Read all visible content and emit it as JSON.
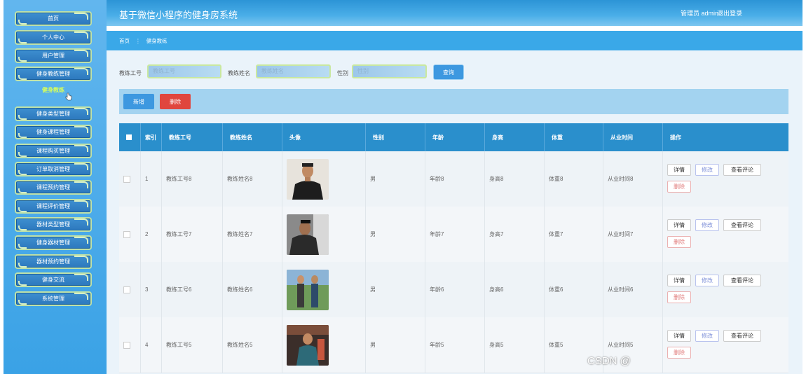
{
  "header": {
    "title": "基于微信小程序的健身房系统",
    "user": "管理员 admin",
    "logout": "退出登录"
  },
  "sidebar": {
    "items": [
      {
        "label": "首页"
      },
      {
        "label": "个人中心"
      },
      {
        "label": "用户管理"
      },
      {
        "label": "健身教练管理"
      },
      {
        "label": "健身类型管理"
      },
      {
        "label": "健身课程管理"
      },
      {
        "label": "课程购买管理"
      },
      {
        "label": "订单取消管理"
      },
      {
        "label": "课程预约管理"
      },
      {
        "label": "课程评价管理"
      },
      {
        "label": "器材类型管理"
      },
      {
        "label": "健身器材管理"
      },
      {
        "label": "器材预约管理"
      },
      {
        "label": "健身交流"
      },
      {
        "label": "系统管理"
      }
    ],
    "active_sub": "健身教练"
  },
  "breadcrumb": {
    "home": "首页",
    "separator": "⋮",
    "current": "健身教练"
  },
  "search": {
    "coach_no_label": "教练工号",
    "coach_no_placeholder": "教练工号",
    "coach_name_label": "教练姓名",
    "coach_name_placeholder": "教练姓名",
    "gender_label": "性别",
    "gender_placeholder": "性别",
    "search_button": "查询"
  },
  "actions": {
    "add": "新增",
    "delete": "删除"
  },
  "table": {
    "headers": [
      "索引",
      "教练工号",
      "教练姓名",
      "头像",
      "性别",
      "年龄",
      "身高",
      "体重",
      "从业时间",
      "操作"
    ],
    "rows": [
      {
        "index": "1",
        "coach_no": "教练工号8",
        "name": "教练姓名8",
        "gender": "男",
        "age": "年龄8",
        "height": "身高8",
        "weight": "体重8",
        "years": "从业时间8"
      },
      {
        "index": "2",
        "coach_no": "教练工号7",
        "name": "教练姓名7",
        "gender": "男",
        "age": "年龄7",
        "height": "身高7",
        "weight": "体重7",
        "years": "从业时间7"
      },
      {
        "index": "3",
        "coach_no": "教练工号6",
        "name": "教练姓名6",
        "gender": "男",
        "age": "年龄6",
        "height": "身高6",
        "weight": "体重6",
        "years": "从业时间6"
      },
      {
        "index": "4",
        "coach_no": "教练工号5",
        "name": "教练姓名5",
        "gender": "男",
        "age": "年龄5",
        "height": "身高5",
        "weight": "体重5",
        "years": "从业时间5"
      }
    ],
    "row_actions": {
      "detail": "详情",
      "edit": "修改",
      "reviews": "查看评论",
      "delete": "删除"
    }
  },
  "watermark": "CSDN @"
}
